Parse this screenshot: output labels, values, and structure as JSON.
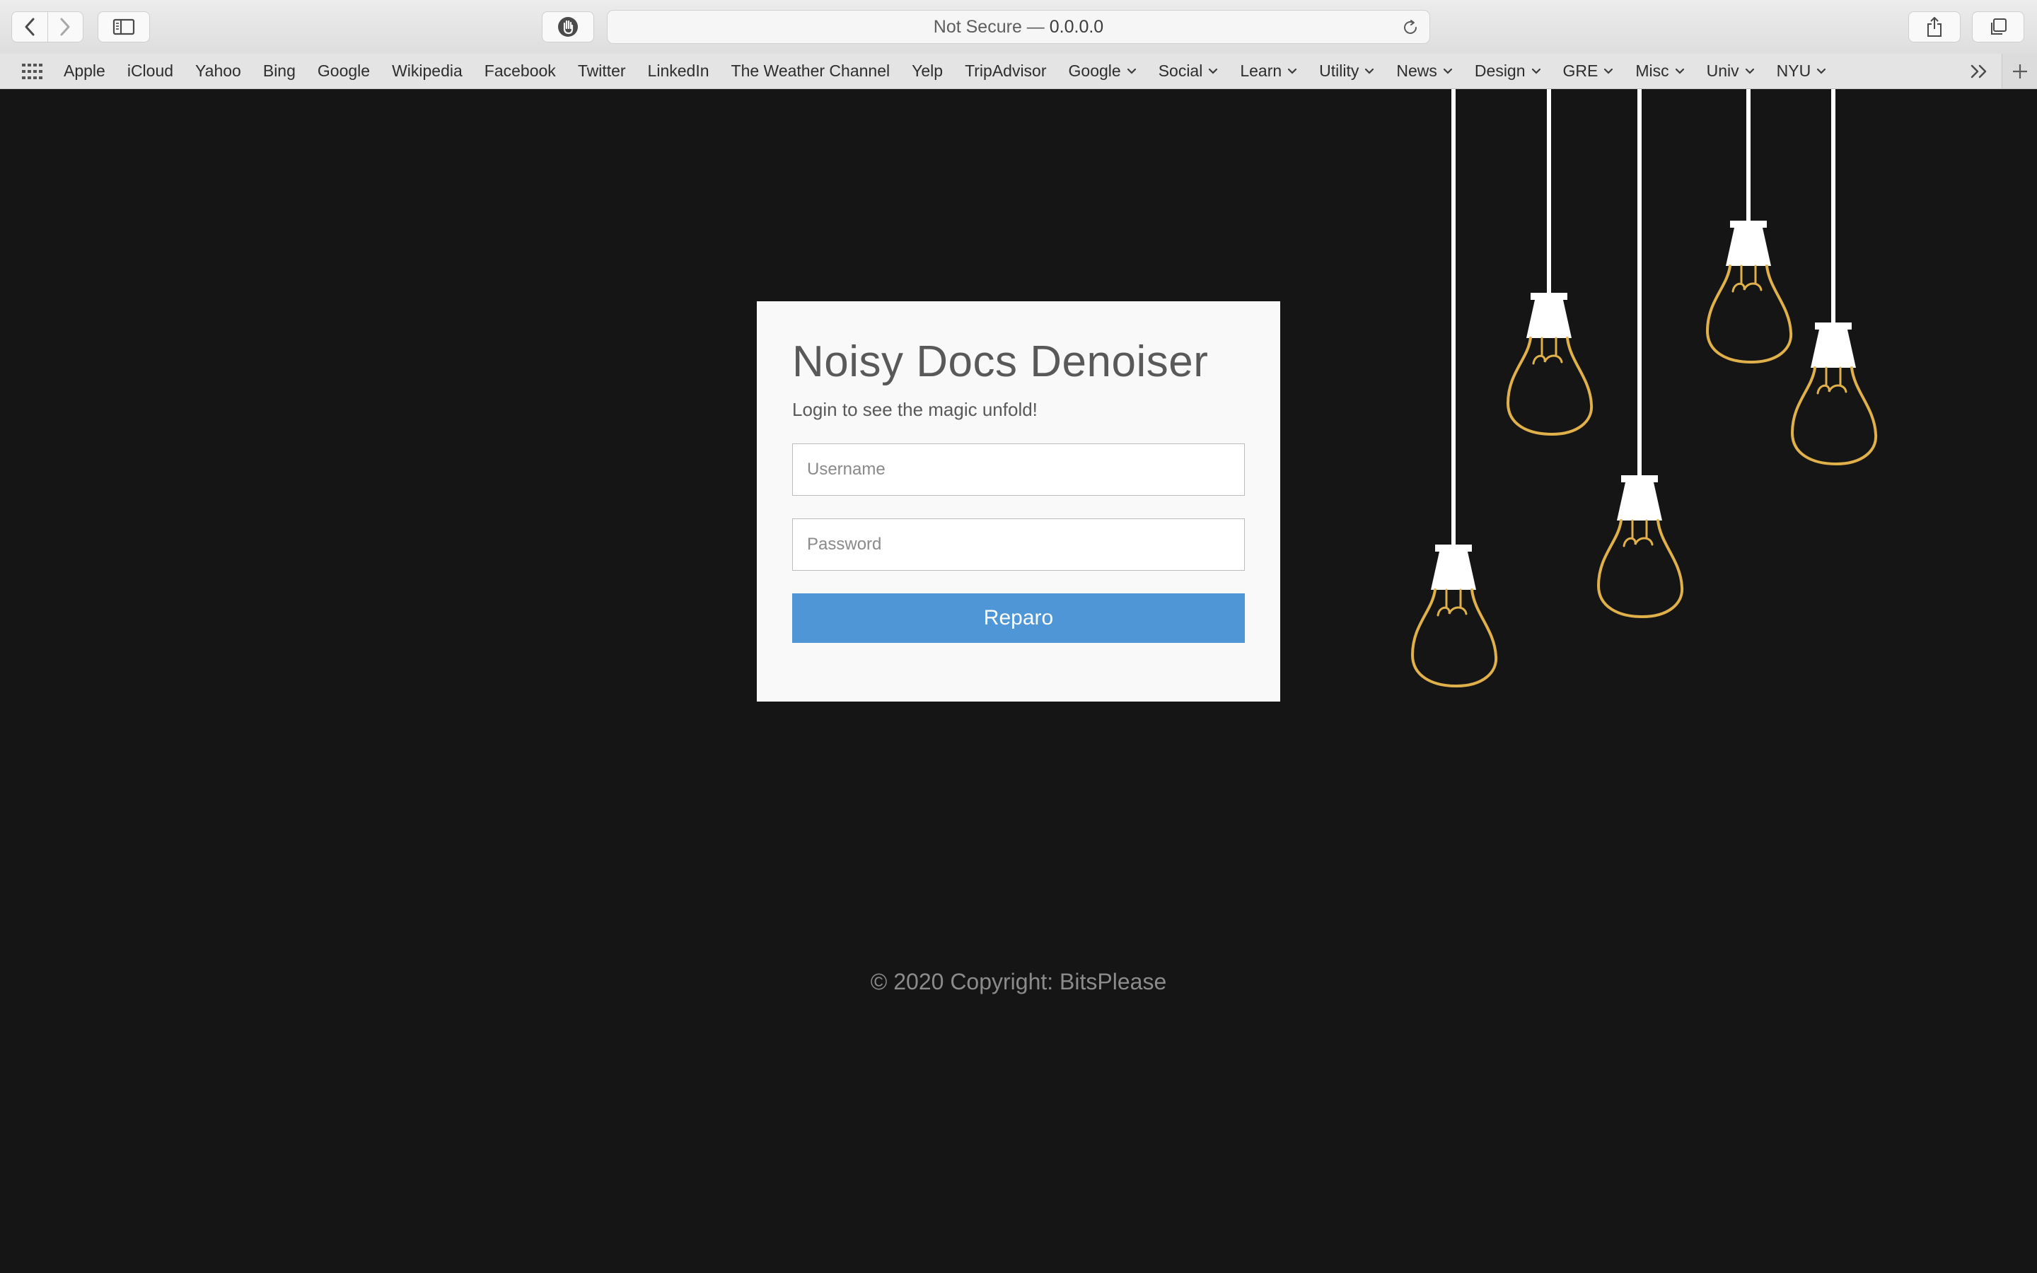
{
  "browser": {
    "url_prefix": "Not Secure —",
    "url_host": "0.0.0.0"
  },
  "favorites": [
    {
      "label": "Apple",
      "folder": false
    },
    {
      "label": "iCloud",
      "folder": false
    },
    {
      "label": "Yahoo",
      "folder": false
    },
    {
      "label": "Bing",
      "folder": false
    },
    {
      "label": "Google",
      "folder": false
    },
    {
      "label": "Wikipedia",
      "folder": false
    },
    {
      "label": "Facebook",
      "folder": false
    },
    {
      "label": "Twitter",
      "folder": false
    },
    {
      "label": "LinkedIn",
      "folder": false
    },
    {
      "label": "The Weather Channel",
      "folder": false
    },
    {
      "label": "Yelp",
      "folder": false
    },
    {
      "label": "TripAdvisor",
      "folder": false
    },
    {
      "label": "Google",
      "folder": true
    },
    {
      "label": "Social",
      "folder": true
    },
    {
      "label": "Learn",
      "folder": true
    },
    {
      "label": "Utility",
      "folder": true
    },
    {
      "label": "News",
      "folder": true
    },
    {
      "label": "Design",
      "folder": true
    },
    {
      "label": "GRE",
      "folder": true
    },
    {
      "label": "Misc",
      "folder": true
    },
    {
      "label": "Univ",
      "folder": true
    },
    {
      "label": "NYU",
      "folder": true
    }
  ],
  "login": {
    "title": "Noisy Docs Denoiser",
    "subtitle": "Login to see the magic unfold!",
    "username_placeholder": "Username",
    "password_placeholder": "Password",
    "submit_label": "Reparo"
  },
  "footer": {
    "copyright": "© 2020 Copyright: BitsPlease"
  },
  "colors": {
    "page_background": "#151515",
    "card_background": "#f9f9f9",
    "button": "#4f96d6",
    "bulb_outline": "#e0b04a",
    "socket": "#ffffff"
  }
}
